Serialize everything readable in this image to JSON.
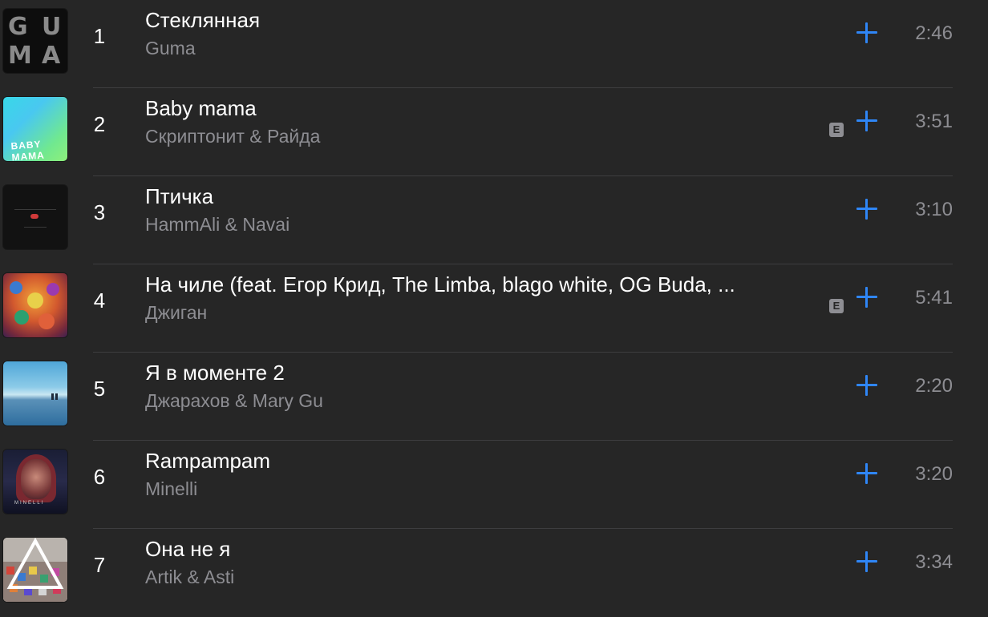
{
  "tracks": [
    {
      "number": "1",
      "title": "Стеклянная",
      "artist": "Guma",
      "duration": "2:46",
      "explicit": false
    },
    {
      "number": "2",
      "title": "Baby mama",
      "artist": "Скриптонит & Райда",
      "duration": "3:51",
      "explicit": true
    },
    {
      "number": "3",
      "title": "Птичка",
      "artist": "HammAli & Navai",
      "duration": "3:10",
      "explicit": false
    },
    {
      "number": "4",
      "title": "На чиле (feat. Егор Крид, The Limba, blago white, OG Buda, ...",
      "artist": "Джиган",
      "duration": "5:41",
      "explicit": true
    },
    {
      "number": "5",
      "title": "Я в моменте 2",
      "artist": "Джарахов & Mary Gu",
      "duration": "2:20",
      "explicit": false
    },
    {
      "number": "6",
      "title": "Rampampam",
      "artist": "Minelli",
      "duration": "3:20",
      "explicit": false
    },
    {
      "number": "7",
      "title": "Она не я",
      "artist": "Artik & Asti",
      "duration": "3:34",
      "explicit": false
    }
  ],
  "artwork": {
    "guma_letters": [
      "G",
      "U",
      "M",
      "A"
    ],
    "baby_mama_text": "BABY MAMA",
    "minelli_text": "MINELLI"
  },
  "explicit_label": "E",
  "colors": {
    "background": "#262626",
    "accent": "#2f86f6",
    "secondary_text": "#8d8d92",
    "separator": "#3d3d3f"
  },
  "icons": {
    "add": "plus-icon",
    "explicit": "explicit-badge-icon"
  }
}
